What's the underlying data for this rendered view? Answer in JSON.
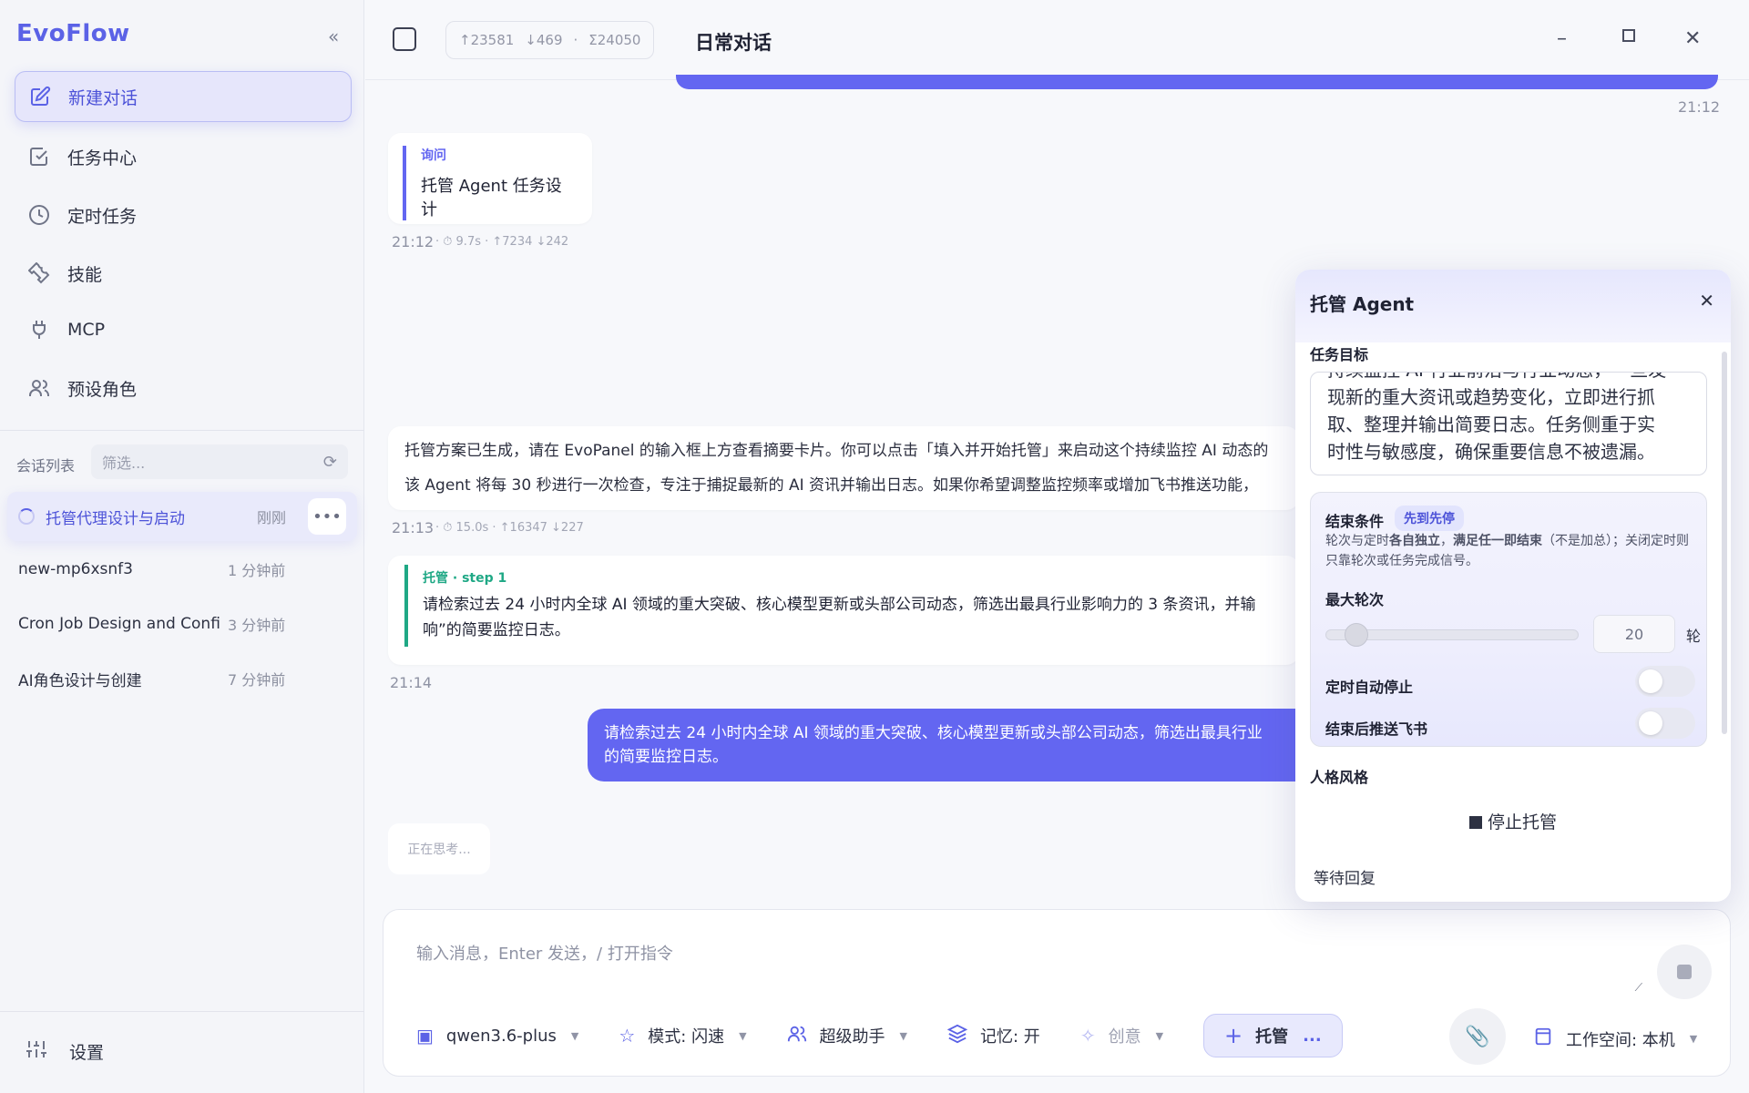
{
  "app": {
    "logo": "EvoFlow",
    "collapse": "«"
  },
  "nav": [
    {
      "label": "新建对话"
    },
    {
      "label": "任务中心"
    },
    {
      "label": "定时任务"
    },
    {
      "label": "技能"
    },
    {
      "label": "MCP"
    },
    {
      "label": "预设角色"
    }
  ],
  "sessions": {
    "label": "会话列表",
    "filter_placeholder": "筛选...",
    "items": [
      {
        "title": "托管代理设计与启动",
        "time": "刚刚"
      },
      {
        "title": "new-mp6xsnf3",
        "time": "1 分钟前"
      },
      {
        "title": "Cron Job Design and Confi...",
        "time": "3 分钟前"
      },
      {
        "title": "AI角色设计与创建",
        "time": "7 分钟前"
      }
    ]
  },
  "settings_label": "设置",
  "topbar": {
    "up": "↑23581",
    "down": "↓469",
    "dot": "·",
    "total": "Σ24050",
    "title": "日常对话"
  },
  "chat": {
    "ts1": "21:12",
    "ask_tag": "询问",
    "ask_text": "托管 Agent 任务设计",
    "ask_meta_time": "21:12",
    "ask_meta": "· ⏱ 9.7s · ↑7234 ↓242",
    "reply_line1": "托管方案已生成，请在 EvoPanel 的输入框上方查看摘要卡片。你可以点击「填入并开始托管」来启动这个持续监控 AI 动态的",
    "reply_line2": "该 Agent 将每 30 秒进行一次检查，专注于捕捉最新的 AI 资讯并输出日志。如果你希望调整监控频率或增加飞书推送功能，",
    "reply_meta_time": "21:13",
    "reply_meta": "· ⏱ 15.0s · ↑16347 ↓227",
    "step_tag": "托管 · step 1",
    "step_line1": "请检索过去 24 小时内全球 AI 领域的重大突破、核心模型更新或头部公司动态，筛选出最具行业影响力的 3 条资讯，并输",
    "step_line2": "响”的简要监控日志。",
    "step_time": "21:14",
    "user_line1": "请检索过去 24 小时内全球 AI 领域的重大突破、核心模型更新或头部公司动态，筛选出最具行业",
    "user_line2": "的简要监控日志。",
    "thinking": "正在思考..."
  },
  "composer": {
    "placeholder": "输入消息，Enter 发送，/ 打开指令",
    "model": "qwen3.6-plus",
    "mode": "模式: 闪速",
    "role": "超级助手",
    "memory": "记忆: 开",
    "creative": "创意",
    "tuoguan": "托管",
    "tuoguan_more": "...",
    "workspace": "工作空间: 本机"
  },
  "panel": {
    "title": "托管 Agent",
    "goal_label": "任务目标",
    "goal_lines": [
      "持续监控 AI 行业前沿与行业动态，一旦发",
      "现新的重大资讯或趋势变化，立即进行抓",
      "取、整理并输出简要日志。任务侧重于实",
      "时性与敏感度，确保重要信息不被遗漏。"
    ],
    "end_label": "结束条件",
    "end_badge": "先到先停",
    "end_desc_1": "轮次与定时",
    "end_desc_b1": "各自独立",
    "end_desc_2": "，",
    "end_desc_b2": "满足任一即结束",
    "end_desc_3": "（不是加总）；关闭定时则只靠轮次或任务完成信号。",
    "max_rounds_label": "最大轮次",
    "max_rounds_value": "20",
    "max_rounds_fraction": 0.08,
    "rounds_unit": "轮",
    "timer_stop_label": "定时自动停止",
    "push_label": "结束后推送飞书",
    "style_label": "人格风格",
    "stop_label": "停止托管",
    "waiting": "等待回复"
  },
  "colors": {
    "accent": "#6366f1",
    "green": "#1fa885"
  }
}
